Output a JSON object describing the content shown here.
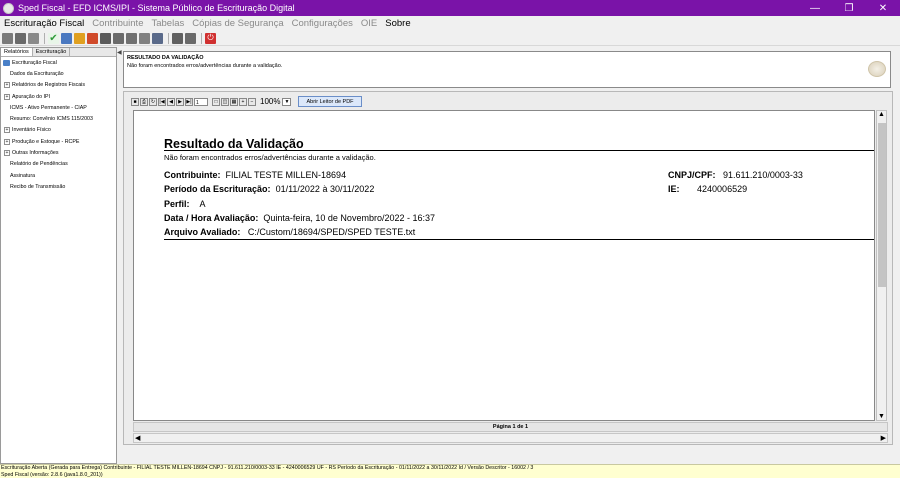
{
  "window": {
    "title": "Sped Fiscal - EFD ICMS/IPI - Sistema Público de Escrituração Digital"
  },
  "menu": [
    {
      "label": "Escrituração Fiscal",
      "enabled": true
    },
    {
      "label": "Contribuinte",
      "enabled": false
    },
    {
      "label": "Tabelas",
      "enabled": false
    },
    {
      "label": "Cópias de Segurança",
      "enabled": false
    },
    {
      "label": "Configurações",
      "enabled": false
    },
    {
      "label": "OIE",
      "enabled": false
    },
    {
      "label": "Sobre",
      "enabled": true
    }
  ],
  "toolbar_icons": [
    "new-icon",
    "open-icon",
    "import-icon",
    "validate-icon",
    "sign-icon",
    "edit-icon",
    "delete-icon",
    "generate-icon",
    "report-icon",
    "backup-icon",
    "restore-icon",
    "transmit-icon",
    "print-icon",
    "export-icon",
    "exit-icon"
  ],
  "left_tabs": [
    "Relatórios",
    "Escrituração"
  ],
  "tree": [
    {
      "label": "Escrituração Fiscal",
      "level": 0,
      "expandable": false,
      "icon": true
    },
    {
      "label": "Dados da Escrituração",
      "level": 1,
      "expandable": false
    },
    {
      "label": "Relatórios de Registros Fiscais",
      "level": 1,
      "expandable": true
    },
    {
      "label": "Apuração do IPI",
      "level": 1,
      "expandable": true
    },
    {
      "label": "ICMS - Ativo Permanente - CIAP",
      "level": 1,
      "expandable": false
    },
    {
      "label": "Resumo: Convênio ICMS 115/2003",
      "level": 1,
      "expandable": false
    },
    {
      "label": "Inventário Físico",
      "level": 1,
      "expandable": true
    },
    {
      "label": "Produção e Estoque - RCPE",
      "level": 1,
      "expandable": true
    },
    {
      "label": "Outras Informações",
      "level": 1,
      "expandable": true
    },
    {
      "label": "Relatório de Pendências",
      "level": 1,
      "expandable": false
    },
    {
      "label": "Assinatura",
      "level": 1,
      "expandable": false
    },
    {
      "label": "Recibo de Transmissão",
      "level": 1,
      "expandable": false
    }
  ],
  "message": {
    "heading": "RESULTADO DA VALIDAÇÃO",
    "text": "Não foram encontrados erros/advertências durante a validação."
  },
  "viewer": {
    "page_input": "1",
    "zoom": "100%",
    "pdf_button": "Abrir Leitor de PDF",
    "page_status": "Página 1 de 1"
  },
  "report": {
    "title": "Resultado da Validação",
    "subtitle": "Não foram encontrados erros/advertências durante a validação.",
    "contribuinte_label": "Contribuinte:",
    "contribuinte": "FILIAL TESTE MILLEN-18694",
    "cnpj_label": "CNPJ/CPF:",
    "cnpj": "91.611.210/0003-33",
    "periodo_label": "Período da Escrituração:",
    "periodo": "01/11/2022 à 30/11/2022",
    "ie_label": "IE:",
    "ie": "4240006529",
    "perfil_label": "Perfil:",
    "perfil": "A",
    "data_label": "Data / Hora Avaliação:",
    "data": "Quinta-feira, 10 de Novembro/2022 - 16:37",
    "arquivo_label": "Arquivo Avaliado:",
    "arquivo": "C:/Custom/18694/SPED/SPED TESTE.txt"
  },
  "status": {
    "line1": "Escrituração Aberta (Gerada para Entrega) Contribuinte - FILIAL TESTE MILLEN-18694 CNPJ - 91.611.210/0003-33 IE - 4240006529 UF - RS Período da Escrituração - 01/11/2022 a 30/11/2022 Id / Versão Descritor - 16002 / 3",
    "line2": "Sped Fiscal (versão: 2.8.6 (java1.8.0_201))"
  },
  "colors": {
    "titlebar": "#7a13a8",
    "accent_button": "#dce8fa"
  }
}
